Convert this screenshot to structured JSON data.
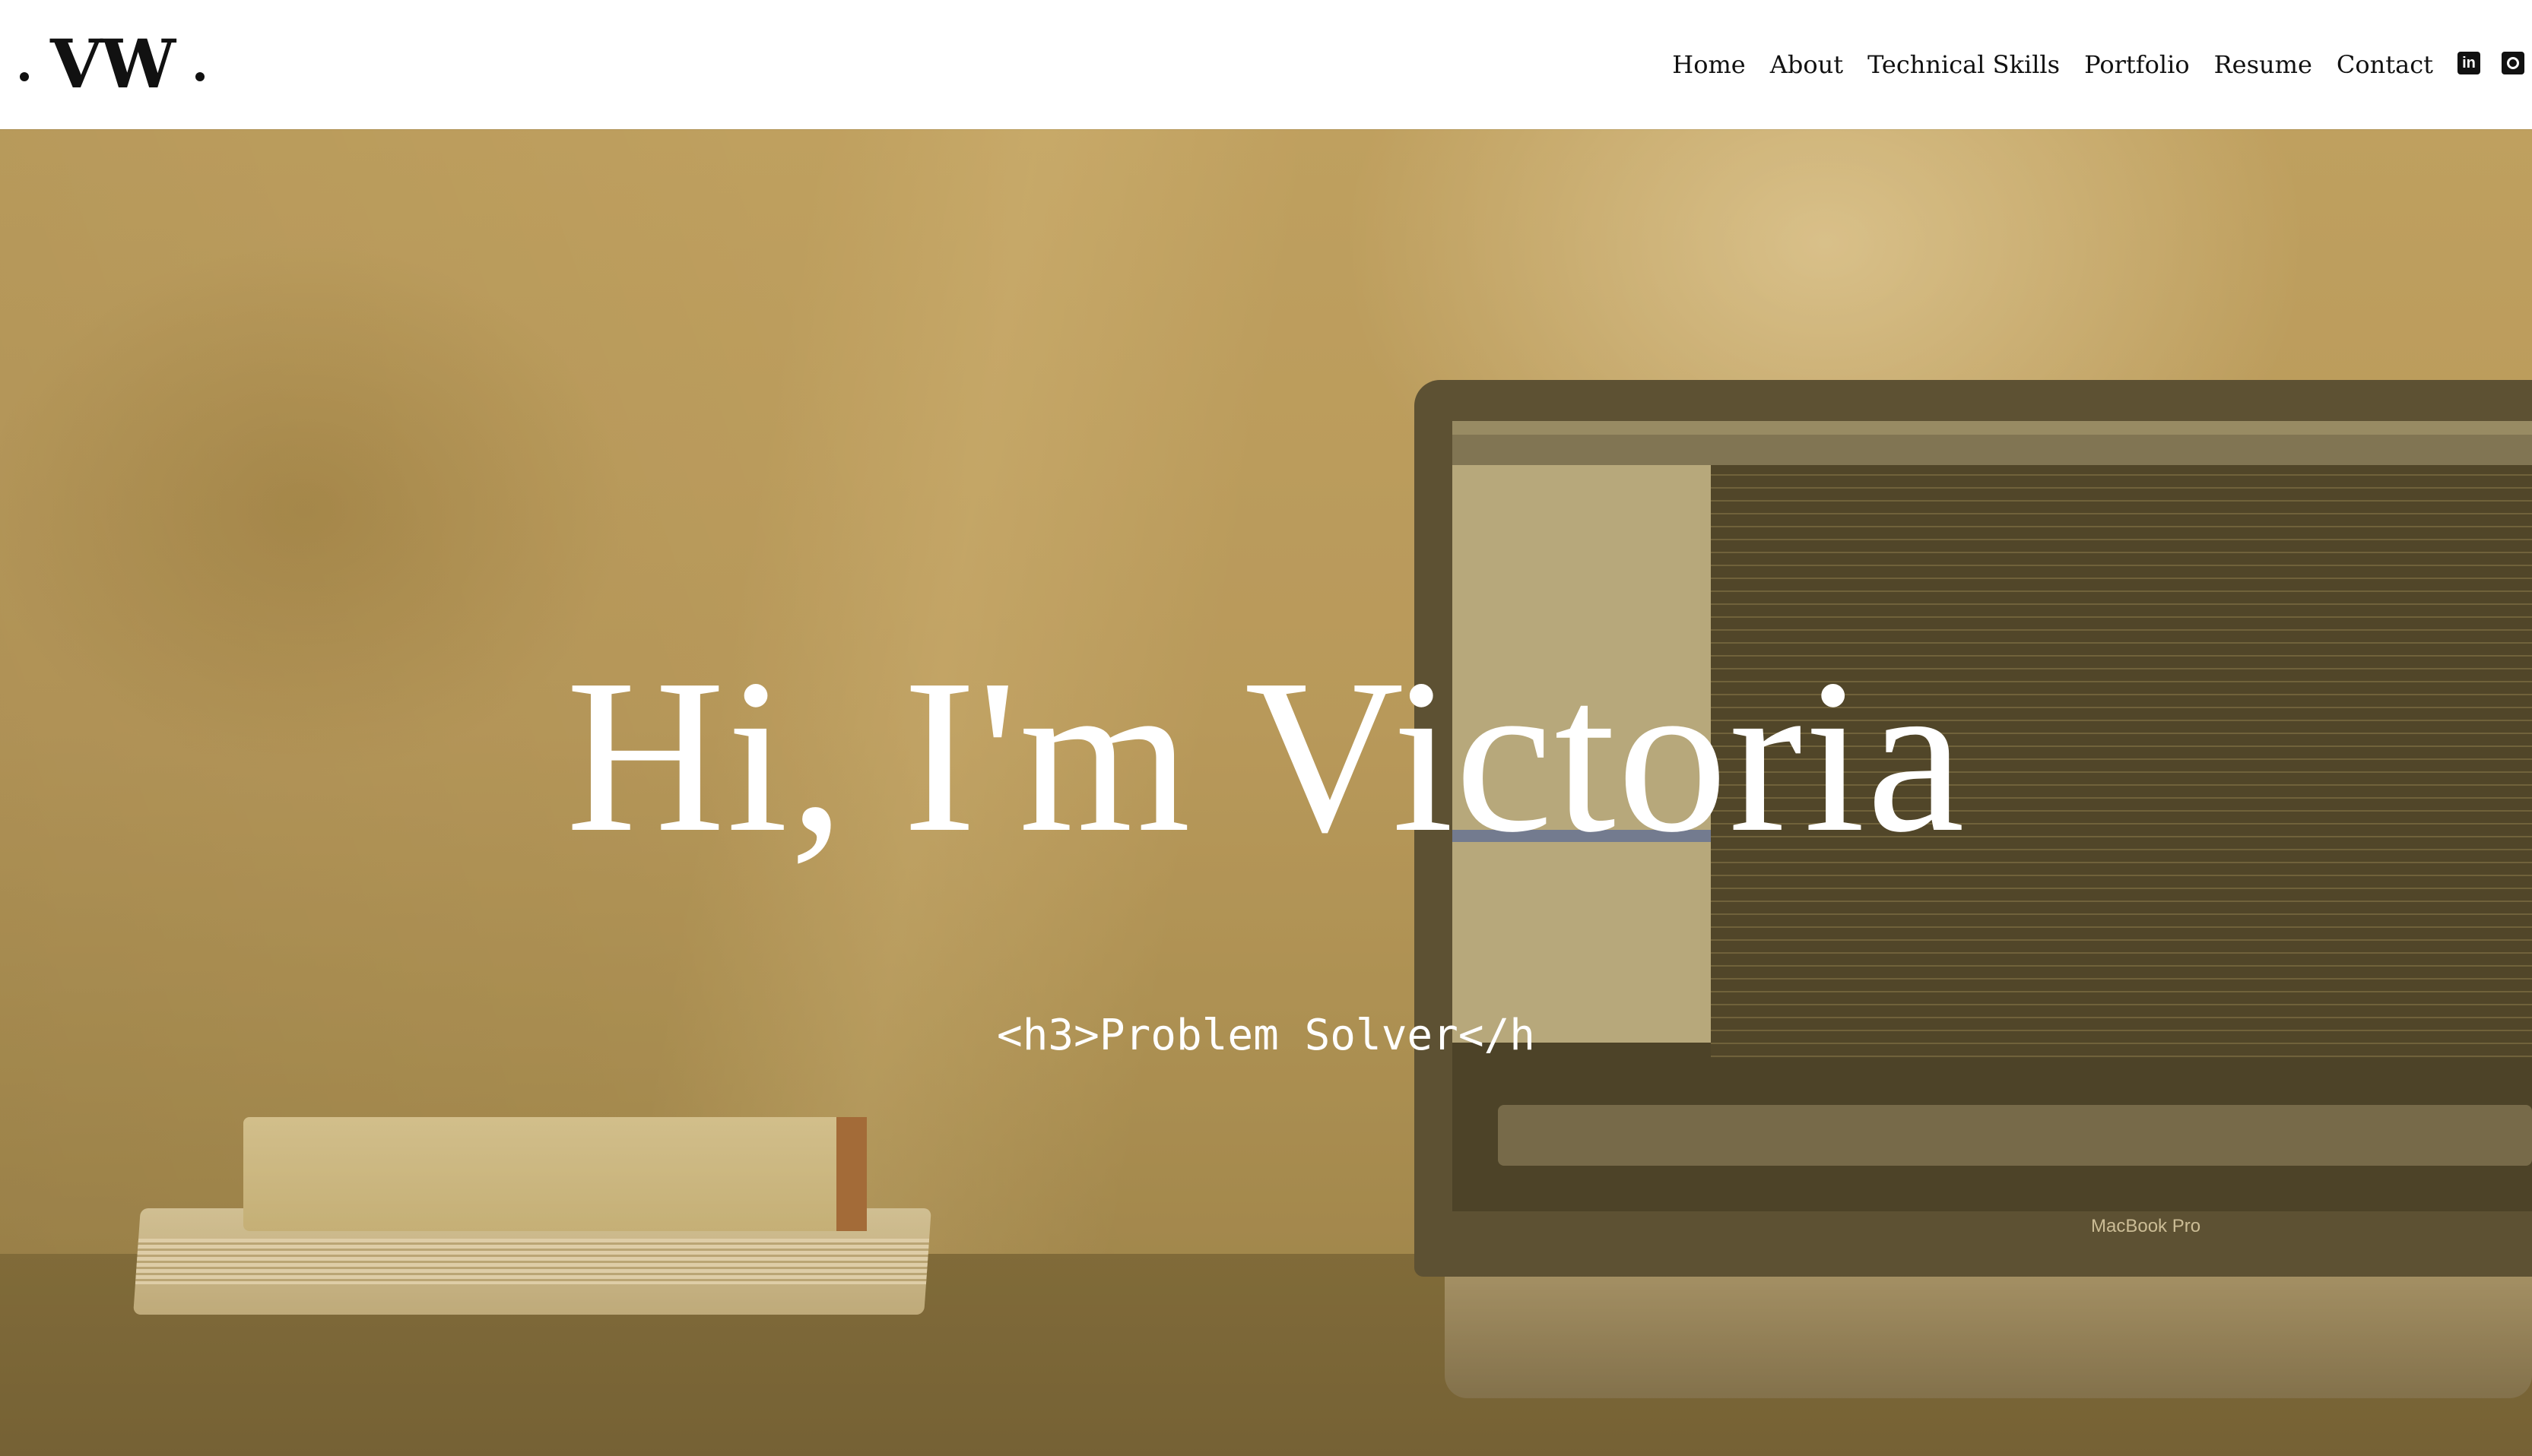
{
  "header": {
    "logo": {
      "text": "VW"
    },
    "nav": [
      "Home",
      "About",
      "Technical Skills",
      "Portfolio",
      "Resume",
      "Contact"
    ],
    "social": [
      {
        "icon": "linkedin-icon",
        "glyph": "in"
      },
      {
        "icon": "github-icon"
      }
    ]
  },
  "hero": {
    "title": "Hi, I'm Victoria",
    "subtitle": "<h3>Problem Solver</h",
    "background": {
      "laptop_label": "MacBook Pro"
    }
  },
  "colors": {
    "header_bg": "#ffffff",
    "nav_text": "#111111",
    "hero_tint": "#bfa060",
    "hero_text": "#ffffff"
  }
}
